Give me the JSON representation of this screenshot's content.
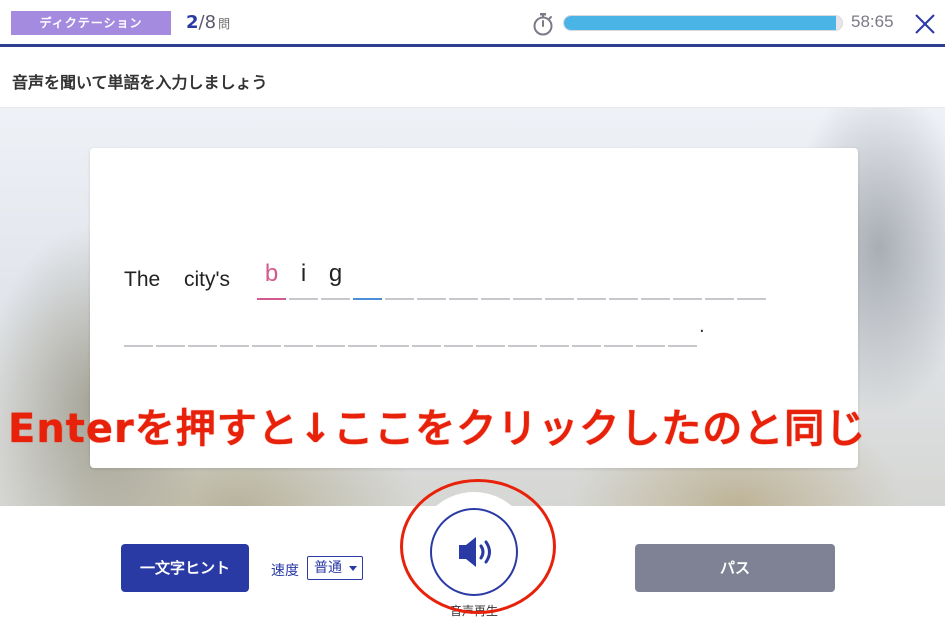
{
  "header": {
    "mode_label": "ディクテーション",
    "question_current": "2",
    "question_total": "/8",
    "question_unit": "問",
    "progress_fraction": 0.98,
    "timer": "58:65"
  },
  "instruction": "音声を聞いて単語を入力しましょう",
  "sentence": {
    "words": [
      "The",
      "city's"
    ],
    "typed_letters": [
      "b",
      "i",
      "g"
    ],
    "row1_slot_count": 16,
    "row2_slot_count": 18,
    "period": "."
  },
  "annotation": {
    "text": "Enterを押すと↓ここをクリックしたのと同じ"
  },
  "controls": {
    "hint_button": "一文字ヒント",
    "speed_label": "速度",
    "speed_value": "普通",
    "play_label": "音声再生",
    "pass_button": "パス"
  },
  "colors": {
    "brand_navy": "#2a3aa5",
    "badge_purple": "#a58be0",
    "progress_blue": "#4ab4e6",
    "hint_pink": "#d35a8c",
    "annotation_red": "#e8220a",
    "pass_gray": "#7f8295"
  },
  "icons": {
    "timer": "stopwatch-icon",
    "close": "close-icon",
    "play": "speaker-icon",
    "speed_dropdown": "caret-down-icon"
  }
}
